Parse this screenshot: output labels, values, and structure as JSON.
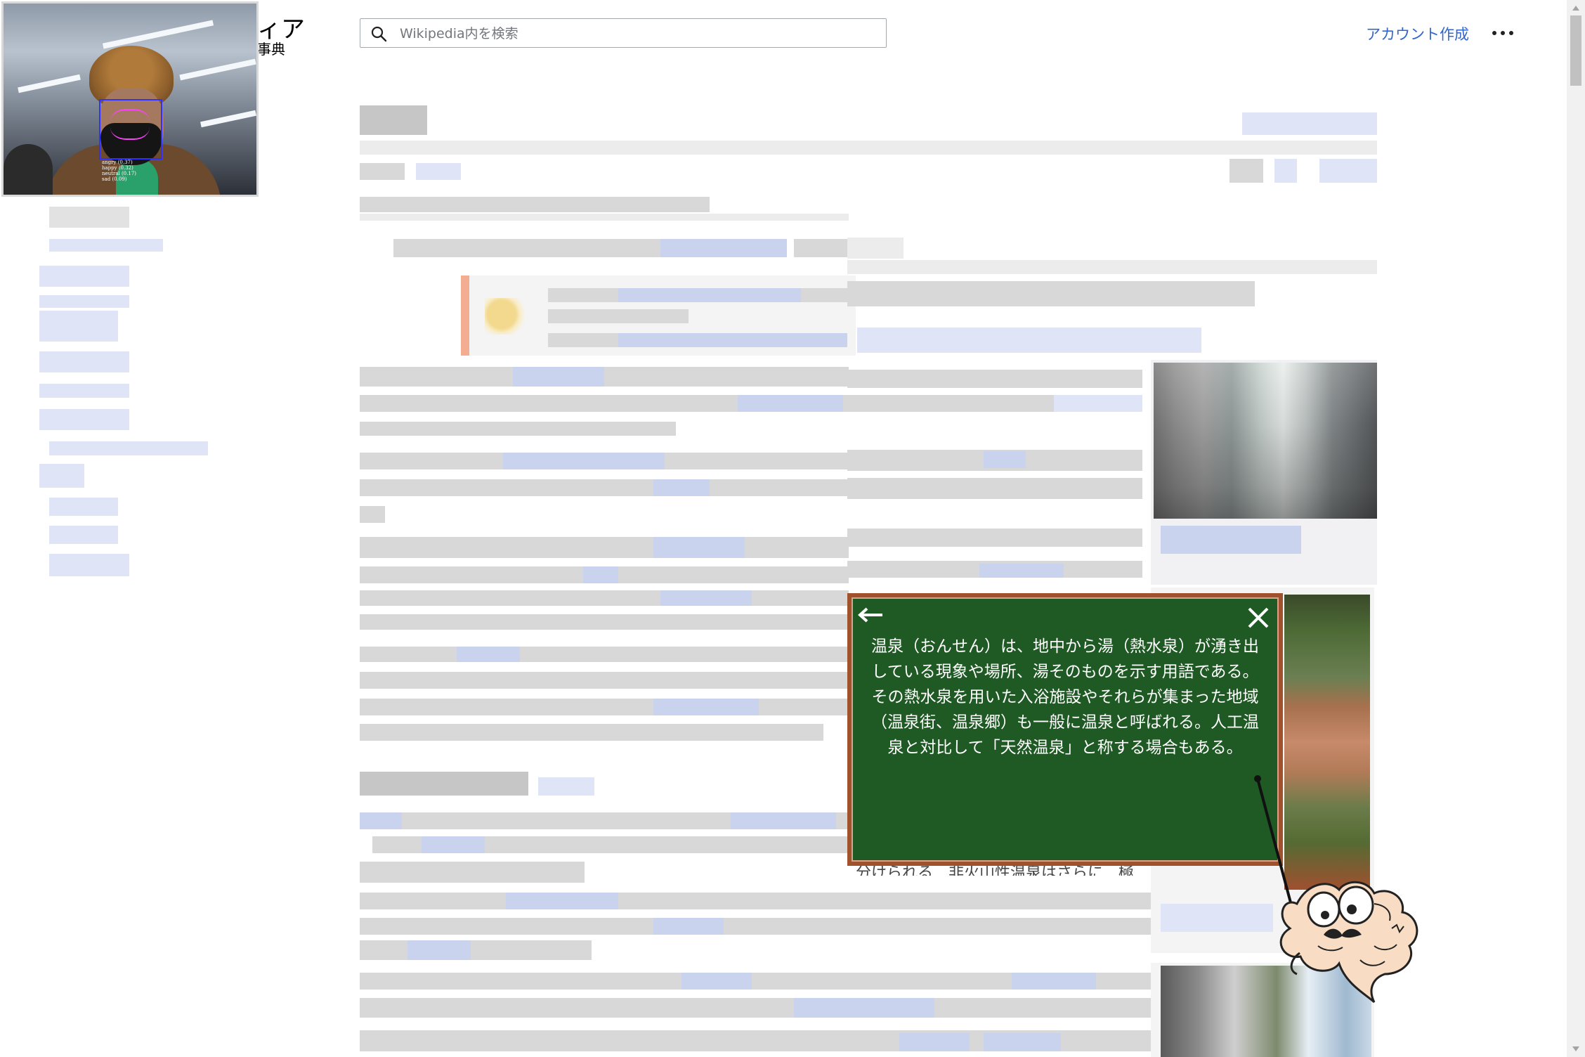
{
  "header": {
    "logo_text": "ィア",
    "logo_sub": "事典",
    "search_placeholder": "Wikipedia内を検索",
    "account_link": "アカウント作成"
  },
  "webcam": {
    "emotions": [
      "angry (0.37)",
      "happy (0.32)",
      "neutral (0.17)",
      "sad (0.09)"
    ]
  },
  "popup": {
    "text": "温泉（おんせん）は、地中から湯（熱水泉）が湧き出している現象や場所、湯そのものを示す用語である。その熱水泉を用いた入浴施設やそれらが集まった地域（温泉街、温泉郷）も一般に温泉と呼ばれる。人工温泉と対比して「天然温泉」と称する場合もある。",
    "board_color": "#1f5a24",
    "frame_color": "#a0522d"
  },
  "partial_text": "分けられる　非火山性温泉はさらに　極",
  "icons": [
    "search-icon",
    "more-icon",
    "back-arrow-icon",
    "close-icon",
    "mascot-brain-icon"
  ]
}
